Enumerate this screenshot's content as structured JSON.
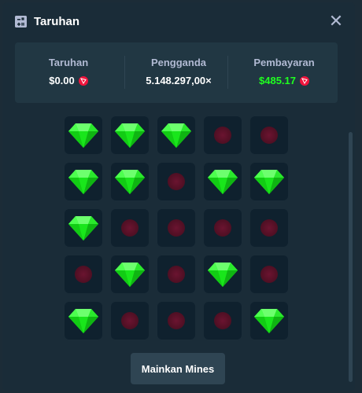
{
  "header": {
    "title": "Taruhan",
    "title_icon": "bet-slip-icon",
    "close_icon": "close-icon"
  },
  "stats": {
    "bet": {
      "label": "Taruhan",
      "value": "$0.00",
      "coin_icon": "tron-coin-icon"
    },
    "multiplier": {
      "label": "Pengganda",
      "value": "5.148.297,00×"
    },
    "payout": {
      "label": "Pembayaran",
      "value": "$485.17",
      "coin_icon": "tron-coin-icon"
    }
  },
  "grid": {
    "rows": [
      [
        "gem",
        "gem",
        "gem",
        "mine",
        "mine"
      ],
      [
        "gem",
        "gem",
        "mine",
        "gem",
        "gem"
      ],
      [
        "gem",
        "mine",
        "mine",
        "mine",
        "mine"
      ],
      [
        "mine",
        "gem",
        "mine",
        "gem",
        "mine"
      ],
      [
        "gem",
        "mine",
        "mine",
        "mine",
        "gem"
      ]
    ]
  },
  "button": {
    "label": "Mainkan Mines"
  },
  "colors": {
    "gem": "#1fff20",
    "mine": "#5a1128",
    "payout": "#1fff20",
    "tile": "#0f212e"
  }
}
